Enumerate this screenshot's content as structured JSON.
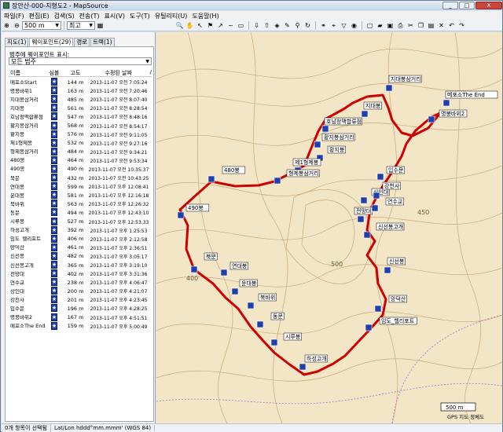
{
  "window": {
    "title": "장안산-000-지형도2 - MapSource",
    "controls": [
      "_",
      "□",
      "X"
    ]
  },
  "menu": [
    "파일(F)",
    "편집(E)",
    "검색(S)",
    "전송(T)",
    "표시(V)",
    "도구(T)",
    "유틸리티(U)",
    "도움말(H)"
  ],
  "toolbar": {
    "zoom_value": "500 m",
    "detail_value": "최고"
  },
  "sidebar": {
    "tabs": [
      "지도(1)",
      "웨이포인트(29)",
      "경로",
      "트랙(1)"
    ],
    "active_tab": 1,
    "filter_label": "범주에 웨이포인트 표시:",
    "filter_value": "모든 범주",
    "columns": [
      "이름",
      "심볼",
      "고도",
      "수정된 날짜",
      "/"
    ],
    "waypoints": [
      {
        "name": "메포소Start",
        "alt": "144 m",
        "date": "2013-11-07 오전 7:05:24"
      },
      {
        "name": "명봉바위1",
        "alt": "163 m",
        "date": "2013-11-07 오전 7:20:46"
      },
      {
        "name": "지대봉삼거리",
        "alt": "485 m",
        "date": "2013-11-07 오전 8:07:40"
      },
      {
        "name": "지대봉",
        "alt": "561 m",
        "date": "2013-11-07 오전 8:28:54"
      },
      {
        "name": "호남정맥합류점",
        "alt": "547 m",
        "date": "2013-11-07 오전 8:48:16"
      },
      {
        "name": "황지봉삼거리",
        "alt": "568 m",
        "date": "2013-11-07 오전 8:54:17"
      },
      {
        "name": "황지봉",
        "alt": "576 m",
        "date": "2013-11-07 오전 9:11:05"
      },
      {
        "name": "제1형제봉",
        "alt": "532 m",
        "date": "2013-11-07 오전 9:27:16"
      },
      {
        "name": "형제봉삼거리",
        "alt": "484 m",
        "date": "2013-11-07 오전 9:34:21"
      },
      {
        "name": "480봉",
        "alt": "464 m",
        "date": "2013-11-07 오전 9:53:34"
      },
      {
        "name": "490봉",
        "alt": "490 m",
        "date": "2013-11-07 오전 10:35:37"
      },
      {
        "name": "북문",
        "alt": "432 m",
        "date": "2013-11-07 오전 10:43:25"
      },
      {
        "name": "연대봉",
        "alt": "599 m",
        "date": "2013-11-07 오후 12:08:41"
      },
      {
        "name": "운대봉",
        "alt": "581 m",
        "date": "2013-11-07 오후 12:16:18"
      },
      {
        "name": "북바위",
        "alt": "563 m",
        "date": "2013-11-07 오후 12:26:32"
      },
      {
        "name": "동문",
        "alt": "494 m",
        "date": "2013-11-07 오후 12:43:10"
      },
      {
        "name": "시루봉",
        "alt": "527 m",
        "date": "2013-11-07 오후 12:53:33"
      },
      {
        "name": "하성고개",
        "alt": "392 m",
        "date": "2013-11-07 오후 1:25:53"
      },
      {
        "name": "임도_헬리포트",
        "alt": "406 m",
        "date": "2013-11-07 오후 2:12:58"
      },
      {
        "name": "망덕산",
        "alt": "461 m",
        "date": "2013-11-07 오후 2:36:51"
      },
      {
        "name": "신선봉",
        "alt": "482 m",
        "date": "2013-11-07 오후 3:05:17"
      },
      {
        "name": "신선봉고개",
        "alt": "365 m",
        "date": "2013-11-07 오후 3:19:10"
      },
      {
        "name": "전망대",
        "alt": "402 m",
        "date": "2013-11-07 오후 3:31:36"
      },
      {
        "name": "연수교",
        "alt": "238 m",
        "date": "2013-11-07 오후 4:06:47"
      },
      {
        "name": "상인대",
        "alt": "200 m",
        "date": "2013-11-07 오후 4:21:07"
      },
      {
        "name": "강천사",
        "alt": "201 m",
        "date": "2013-11-07 오후 4:23:45"
      },
      {
        "name": "입수문",
        "alt": "196 m",
        "date": "2013-11-07 오후 4:28:25"
      },
      {
        "name": "명봉바위2",
        "alt": "167 m",
        "date": "2013-11-07 오후 4:51:51"
      },
      {
        "name": "메포소The End",
        "alt": "159 m",
        "date": "2013-11-07 오후 5:00:49"
      }
    ]
  },
  "map": {
    "labels": [
      "지대봉삼거리",
      "지대봉",
      "호남정맥합류점",
      "황지봉삼거리",
      "황지봉",
      "제1형제봉",
      "형제봉삼거리",
      "480봉",
      "490봉",
      "북문",
      "연대봉",
      "운대봉",
      "북바위",
      "동문",
      "시루봉",
      "하성고개",
      "임도_헬리포트",
      "망덕산",
      "신선봉",
      "신선봉고개",
      "전망대",
      "연수교",
      "상인대",
      "강천사",
      "입수문",
      "명봉바위2",
      "메포소The End"
    ],
    "contours": [
      "450",
      "500",
      "400"
    ],
    "scale_label": "500 m",
    "copyright": "GPS 지도 정체도"
  },
  "status": {
    "selection": "0개 항목이 선택됨",
    "position_format": "Lat/Lon hddd°mm.mmm' (WGS 84)"
  },
  "colors": {
    "track": "#d00000",
    "waypoint": "#1f3fae",
    "terrain": "#f3e6c7",
    "contour": "#c9a978"
  }
}
